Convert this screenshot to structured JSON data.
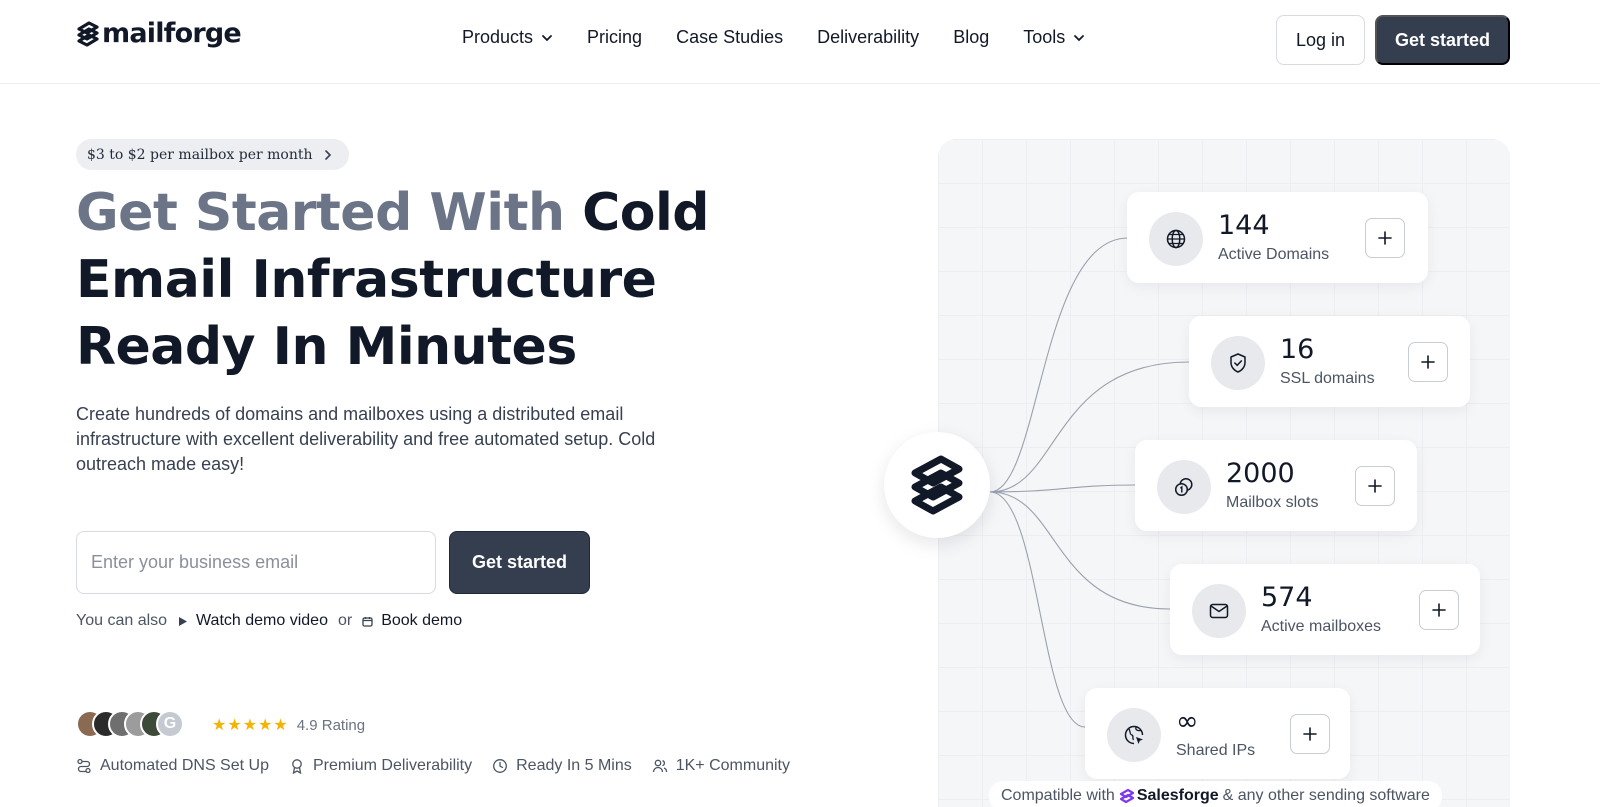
{
  "brand": {
    "name": "mailforge"
  },
  "nav": {
    "items": [
      {
        "label": "Products",
        "has_dropdown": true
      },
      {
        "label": "Pricing",
        "has_dropdown": false
      },
      {
        "label": "Case Studies",
        "has_dropdown": false
      },
      {
        "label": "Deliverability",
        "has_dropdown": false
      },
      {
        "label": "Blog",
        "has_dropdown": false
      },
      {
        "label": "Tools",
        "has_dropdown": true
      }
    ],
    "login_label": "Log in",
    "cta_label": "Get started"
  },
  "hero": {
    "promo": "$3 to $2 per mailbox per month",
    "headline_muted": "Get Started With ",
    "headline_strong": "Cold Email Infrastructure Ready In Minutes",
    "subtext": "Create hundreds of domains and mailboxes using a distributed email infrastructure with excellent deliverability and free automated setup. Cold outreach made easy!",
    "email_placeholder": "Enter your business email",
    "cta_label": "Get started",
    "also_text": "You can also",
    "demo_video_label": "Watch demo video",
    "or_text": "or",
    "book_demo_label": "Book demo",
    "rating_stars": "★★★★★",
    "rating_text": "4.9 Rating",
    "rating_value": 4.9,
    "avatar_badge": "G",
    "features": [
      {
        "label": "Automated DNS Set Up",
        "icon": "route-icon"
      },
      {
        "label": "Premium Deliverability",
        "icon": "award-icon"
      },
      {
        "label": "Ready In 5 Mins",
        "icon": "clock-icon"
      },
      {
        "label": "1K+ Community",
        "icon": "users-icon"
      }
    ]
  },
  "stats": [
    {
      "value": "144",
      "label": "Active Domains",
      "icon": "globe-icon"
    },
    {
      "value": "16",
      "label": "SSL domains",
      "icon": "shield-check-icon"
    },
    {
      "value": "2000",
      "label": "Mailbox slots",
      "icon": "coins-icon"
    },
    {
      "value": "574",
      "label": "Active mailboxes",
      "icon": "mail-icon"
    },
    {
      "value": "∞",
      "label": "Shared IPs",
      "icon": "globe-pointer-icon"
    }
  ],
  "compat": {
    "prefix": "Compatible with",
    "brand": "Salesforge",
    "suffix": "& any other sending software"
  },
  "colors": {
    "primary_button": "#343e4f",
    "headline_muted": "#6b7587",
    "star": "#f5b301",
    "salesforge_purple": "#7c3aed"
  }
}
